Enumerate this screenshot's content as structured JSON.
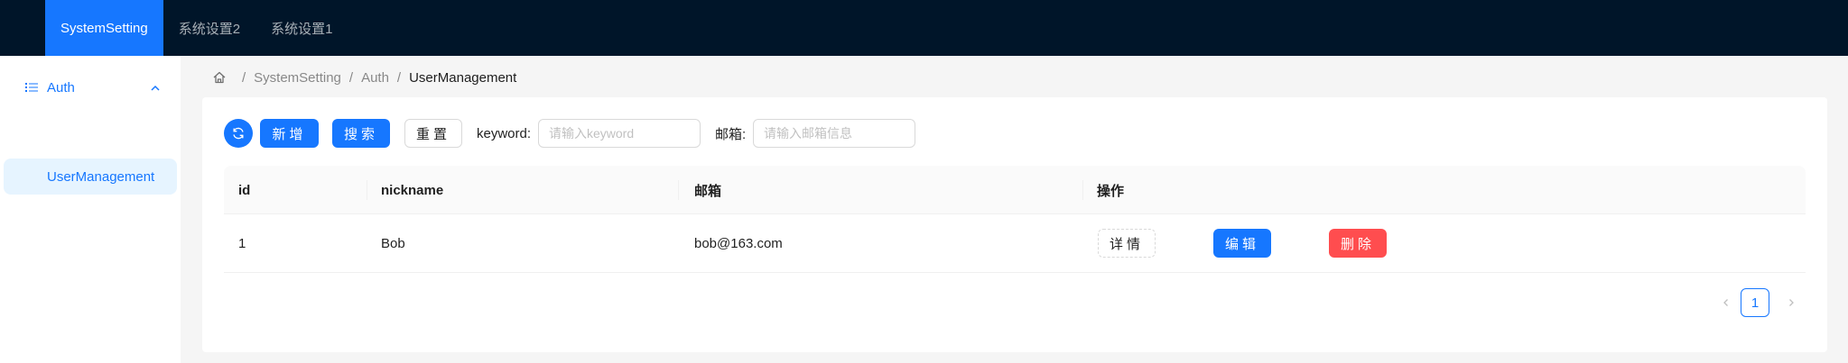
{
  "topnav": {
    "items": [
      {
        "label": "SystemSetting",
        "active": true
      },
      {
        "label": "系统设置2",
        "active": false
      },
      {
        "label": "系统设置1",
        "active": false
      }
    ]
  },
  "sidebar": {
    "submenu_label": "Auth",
    "submenu_icon": "unordered-list-icon",
    "items": [
      {
        "label": "UserManagement",
        "selected": true
      }
    ]
  },
  "breadcrumb": {
    "items": [
      "SystemSetting",
      "Auth",
      "UserManagement"
    ],
    "separator": "/"
  },
  "toolbar": {
    "reload_icon": "sync-icon",
    "add_label": "新增",
    "search_label": "搜索",
    "reset_label": "重置",
    "keyword_label": "keyword:",
    "keyword_placeholder": "请输入keyword",
    "keyword_value": "",
    "email_label": "邮箱:",
    "email_placeholder": "请输入邮箱信息",
    "email_value": ""
  },
  "table": {
    "columns": [
      "id",
      "nickname",
      "邮箱",
      "操作"
    ],
    "rows": [
      {
        "id": "1",
        "nickname": "Bob",
        "email": "bob@163.com",
        "actions": {
          "detail": "详情",
          "edit": "编辑",
          "delete": "删除"
        }
      }
    ]
  },
  "pagination": {
    "current_page": "1"
  },
  "colors": {
    "header_bg": "#001529",
    "primary": "#1677ff",
    "danger": "#ff4d4f",
    "selected_bg": "#e6f4ff"
  }
}
